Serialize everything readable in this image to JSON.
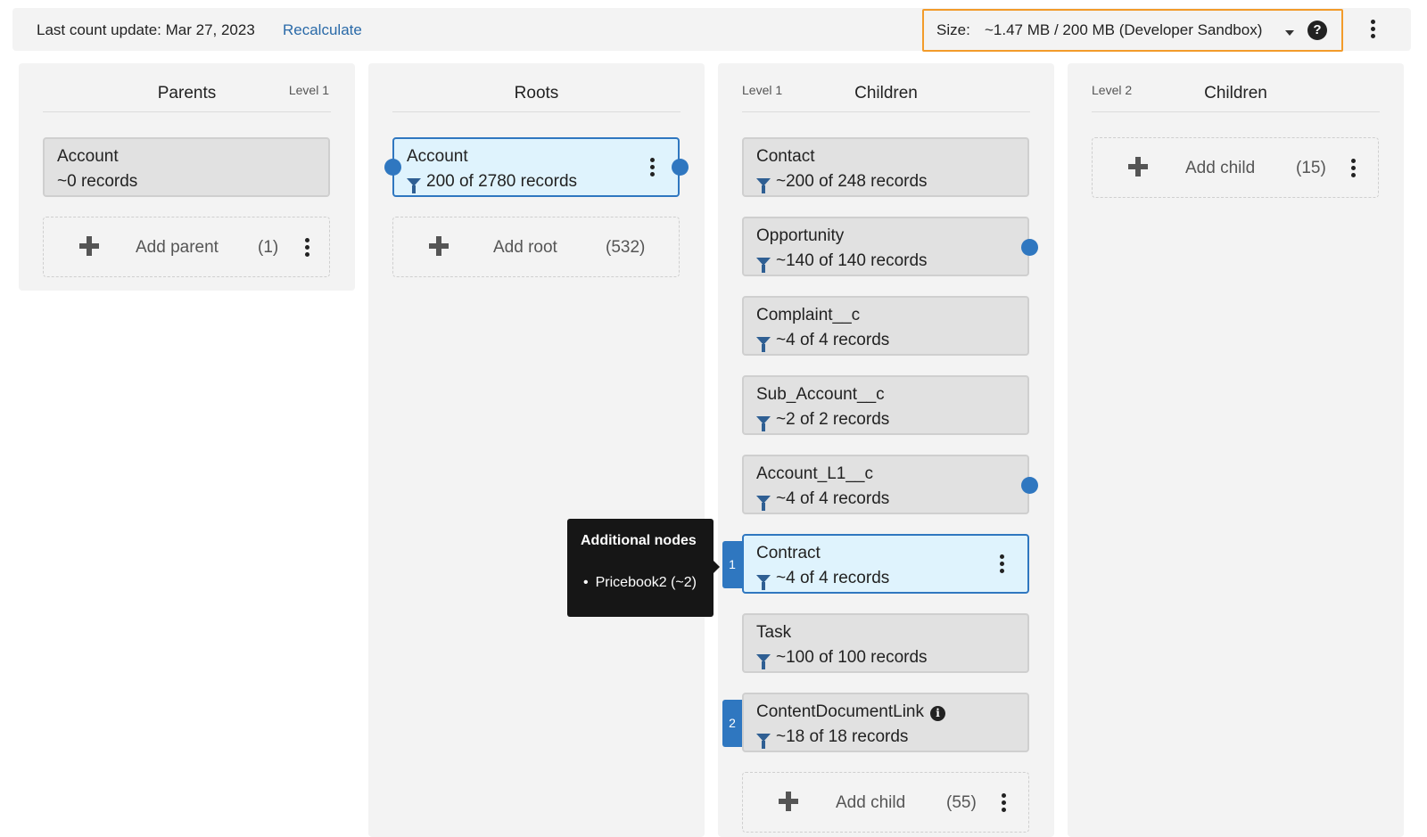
{
  "topbar": {
    "last_update": "Last count update: Mar 27, 2023",
    "recalculate": "Recalculate",
    "size_label": "Size:",
    "size_value": "~1.47 MB / 200 MB (Developer Sandbox)",
    "help_glyph": "?",
    "highlight_color": "#f29b2a"
  },
  "parents": {
    "title": "Parents",
    "level": "Level 1",
    "nodes": [
      {
        "name": "Account",
        "count": "~0 records"
      }
    ],
    "add_label": "Add parent",
    "add_count": "(1)"
  },
  "roots": {
    "title": "Roots",
    "nodes": [
      {
        "name": "Account",
        "count": "200 of 2780 records"
      }
    ],
    "add_label": "Add root",
    "add_count": "(532)"
  },
  "children1": {
    "title": "Children",
    "level": "Level 1",
    "nodes": [
      {
        "name": "Contact",
        "count": "~200 of 248 records"
      },
      {
        "name": "Opportunity",
        "count": "~140 of 140 records"
      },
      {
        "name": "Complaint__c",
        "count": "~4 of 4 records"
      },
      {
        "name": "Sub_Account__c",
        "count": "~2 of 2 records"
      },
      {
        "name": "Account_L1__c",
        "count": "~4 of 4 records"
      },
      {
        "name": "Contract",
        "count": "~4 of 4 records",
        "badge": "1"
      },
      {
        "name": "Task",
        "count": "~100 of 100 records"
      },
      {
        "name": "ContentDocumentLink",
        "count": "~18 of 18 records",
        "badge": "2",
        "info_glyph": "i"
      }
    ],
    "add_label": "Add child",
    "add_count": "(55)"
  },
  "children2": {
    "title": "Children",
    "level": "Level 2",
    "add_label": "Add child",
    "add_count": "(15)"
  },
  "tooltip": {
    "title": "Additional nodes",
    "items": [
      "Pricebook2 (~2)"
    ]
  },
  "colors": {
    "accent": "#2f77c0",
    "link": "#2a6aa8",
    "panel": "#f3f3f3",
    "node": "#e1e1e1",
    "selected": "#dff3fd"
  }
}
